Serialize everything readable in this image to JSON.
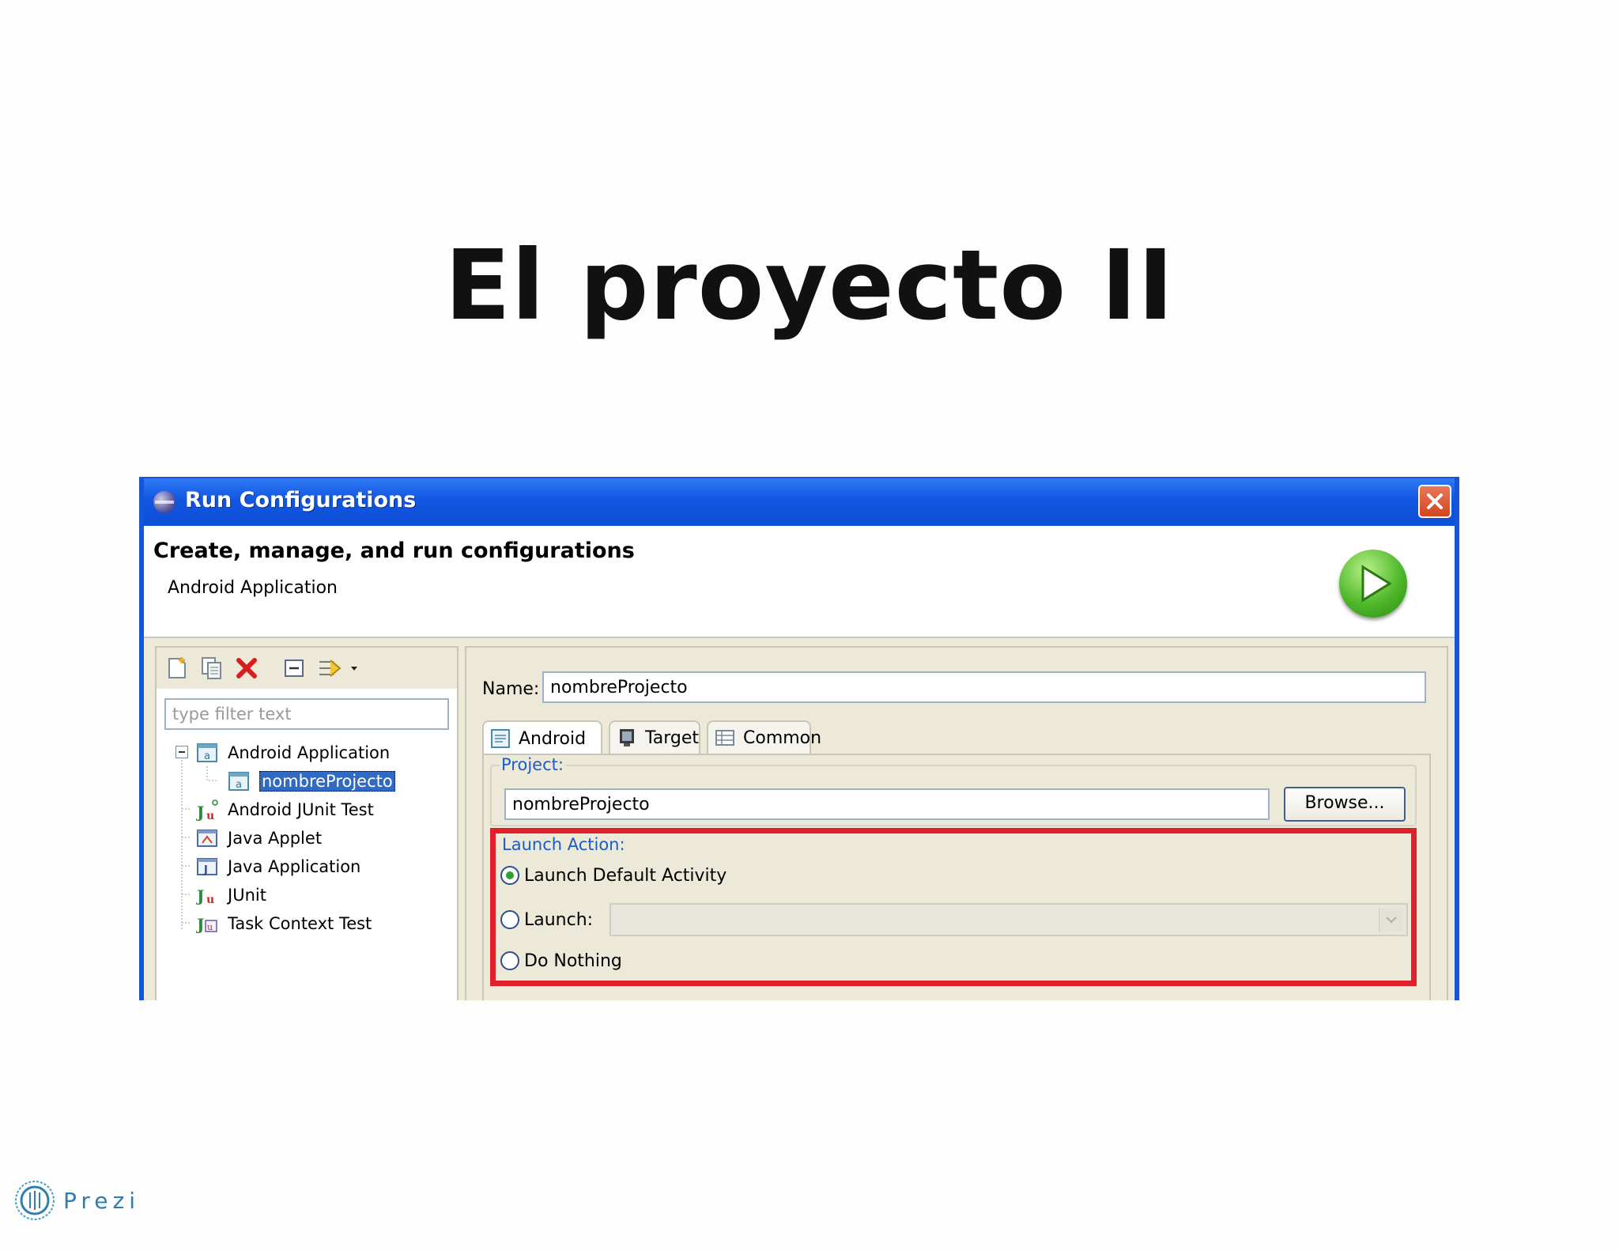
{
  "slide": {
    "title": "El proyecto II"
  },
  "window": {
    "title": "Run Configurations",
    "heading": "Create, manage, and run configurations",
    "subheading": "Android Application"
  },
  "left": {
    "filter_placeholder": "type filter text",
    "tree": [
      {
        "label": "Android Application",
        "level": 0,
        "expanded": true
      },
      {
        "label": "nombreProjecto",
        "level": 1,
        "selected": true
      },
      {
        "label": "Android JUnit Test",
        "level": 0
      },
      {
        "label": "Java Applet",
        "level": 0
      },
      {
        "label": "Java Application",
        "level": 0
      },
      {
        "label": "JUnit",
        "level": 0
      },
      {
        "label": "Task Context Test",
        "level": 0
      }
    ]
  },
  "right": {
    "name_label": "Name:",
    "name_value": "nombreProjecto",
    "tabs": [
      {
        "label": "Android",
        "active": true
      },
      {
        "label": "Target",
        "active": false
      },
      {
        "label": "Common",
        "active": false
      }
    ],
    "project_label": "Project:",
    "project_value": "nombreProjecto",
    "browse_label": "Browse...",
    "launch_action_label": "Launch Action:",
    "radios": [
      {
        "label": "Launch Default Activity",
        "checked": true
      },
      {
        "label": "Launch:",
        "checked": false
      },
      {
        "label": "Do Nothing",
        "checked": false
      }
    ]
  },
  "footer": {
    "brand": "Prezi"
  },
  "colors": {
    "titlebar": "#1256e0",
    "highlight": "#e0202a",
    "selection": "#316ac5"
  }
}
